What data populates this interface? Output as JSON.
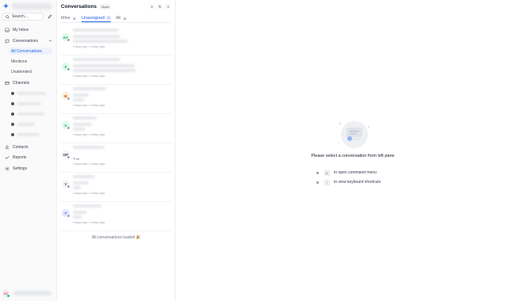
{
  "sidebar": {
    "search_label": "Search...",
    "nav": {
      "my_inbox": "My Inbox",
      "conversations": "Conversations",
      "sub": [
        "All Conversations",
        "Mentions",
        "Unattended"
      ],
      "channels": "Channels",
      "contacts": "Contacts",
      "reports": "Reports",
      "settings": "Settings"
    },
    "user_initials": "VA",
    "accent_color": "#2563eb"
  },
  "list": {
    "title": "Conversations",
    "status": "Open",
    "tabs": [
      {
        "label": "Mine",
        "count": "0"
      },
      {
        "label": "Unassigned",
        "count": "7"
      },
      {
        "label": "All",
        "count": "8"
      }
    ],
    "conversations": [
      {
        "initials": "AA",
        "color": "#16a34a",
        "bg": "#dcfce7",
        "time": "3 days ago • 3 days ago",
        "snippet": ""
      },
      {
        "initials": "A",
        "color": "#16a34a",
        "bg": "#dcfce7",
        "time": "3 days ago • 3 days ago",
        "snippet": ""
      },
      {
        "initials": "B",
        "color": "#c2410c",
        "bg": "#ffedd5",
        "time": "3 days ago • 3 days ago",
        "snippet": ""
      },
      {
        "initials": "A",
        "color": "#16a34a",
        "bg": "#dcfce7",
        "time": "4 days ago • 3 days ago",
        "snippet": ""
      },
      {
        "initials": "OR",
        "color": "#374151",
        "bg": "#f3f4f6",
        "time": "4 days ago • 4 days ago",
        "snippet": "↰ hi"
      },
      {
        "initials": "V",
        "color": "#4b5563",
        "bg": "#f3f4f6",
        "time": "4 days ago • 4 days ago",
        "snippet": ""
      },
      {
        "initials": "T",
        "color": "#4f46e5",
        "bg": "#e0e7ff",
        "time": "4 days ago • 4 days ago",
        "snippet": ""
      }
    ],
    "loaded_msg": "All conversations loaded 🎉"
  },
  "main": {
    "empty_msg": "Please select a conversation from left pane",
    "shortcuts": [
      {
        "mod": "⌘",
        "key": "K",
        "label": "to open command menu"
      },
      {
        "mod": "⌘",
        "key": "/",
        "label": "to view keyboard shortcuts"
      }
    ]
  }
}
